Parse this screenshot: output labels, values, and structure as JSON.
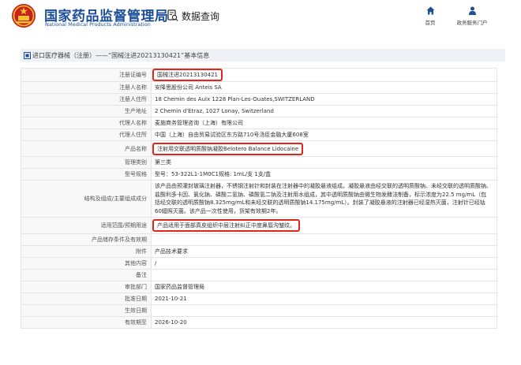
{
  "header": {
    "org_name_cn": "国家药品监督管理局",
    "org_name_en": "National Medical Products Administration",
    "query_label": "数据查询",
    "nav": [
      {
        "label": "首页",
        "icon": "home-icon"
      },
      {
        "label": "政务服务门户",
        "icon": "user-icon"
      }
    ]
  },
  "breadcrumb": "进口医疗器械（注册）——“国械注进20213130421”基本信息",
  "colors": {
    "brand": "#1c4e9a",
    "highlight": "#e0261c",
    "label_bg": "#f8f8f8",
    "breadcrumb_bg": "#eef1f6"
  },
  "rows": [
    {
      "label": "注册证编号",
      "value": "国械注进20213130421",
      "highlight": true
    },
    {
      "label": "注册人名称",
      "value": "安降思股份公司 Anteis SA"
    },
    {
      "label": "注册人住所",
      "value": "18 Chemin des Aulx 1228 Plan-Les-Ouates,SWITZERLAND"
    },
    {
      "label": "生产地址",
      "value": "2 Chemin d'Etraz, 1027 Lonay, Switzerland"
    },
    {
      "label": "代理人名称",
      "value": "麦施商务管理咨询（上海）有限公司"
    },
    {
      "label": "代理人住所",
      "value": "中国（上海）自由贸易试验区东方路710号汤臣金融大厦608室"
    },
    {
      "label": "产品名称",
      "value": "注射用交联透明质酸钠凝胶Belotero Balance Lidocaine",
      "highlight": true
    },
    {
      "label": "管理类别",
      "value": "第三类"
    },
    {
      "label": "型号规格",
      "value": "型号：53-322L1-1M0C1规格: 1mL/支 1支/盒"
    },
    {
      "label": "结构及组成/主要组成成分",
      "value": "该产品由预灌封玻璃注射器，不锈钢注射针和封装在注射器中的凝胶悬液组成。凝胶悬液由经交联的透明质酸钠、未经交联的透明质酸钠、盐酸利多卡因、氯化钠、磷酸二氢钠、磷酸氢二钠及注射用水组成，其中透明质酸钠由微生物发酵法制备，标示浓度为22.5 mg/mL（包括经交联的透明质酸钠8.325mg/mL和未经交联的透明质酸钠14.175mg/mL）。封装了凝胶悬液的注射器已经湿热灭菌，注射针已经钴60辐照灭菌。该产品一次性使用，货架有效期2年。",
      "long": true
    },
    {
      "label": "适用范围/预期用途",
      "value": "产品适用于面部真皮组织中层注射纠正中度鼻唇沟皱纹。",
      "highlight": true
    },
    {
      "label": "产品储存条件及有效期",
      "value": ""
    },
    {
      "label": "附件",
      "value": "产品技术要求"
    },
    {
      "label": "其他内容",
      "value": "/"
    },
    {
      "label": "备注",
      "value": ""
    },
    {
      "label": "审批部门",
      "value": "国家药品监督管理局"
    },
    {
      "label": "批准日期",
      "value": "2021-10-21"
    },
    {
      "label": "生效日期",
      "value": ""
    },
    {
      "label": "有效期至",
      "value": "2026-10-20"
    }
  ]
}
